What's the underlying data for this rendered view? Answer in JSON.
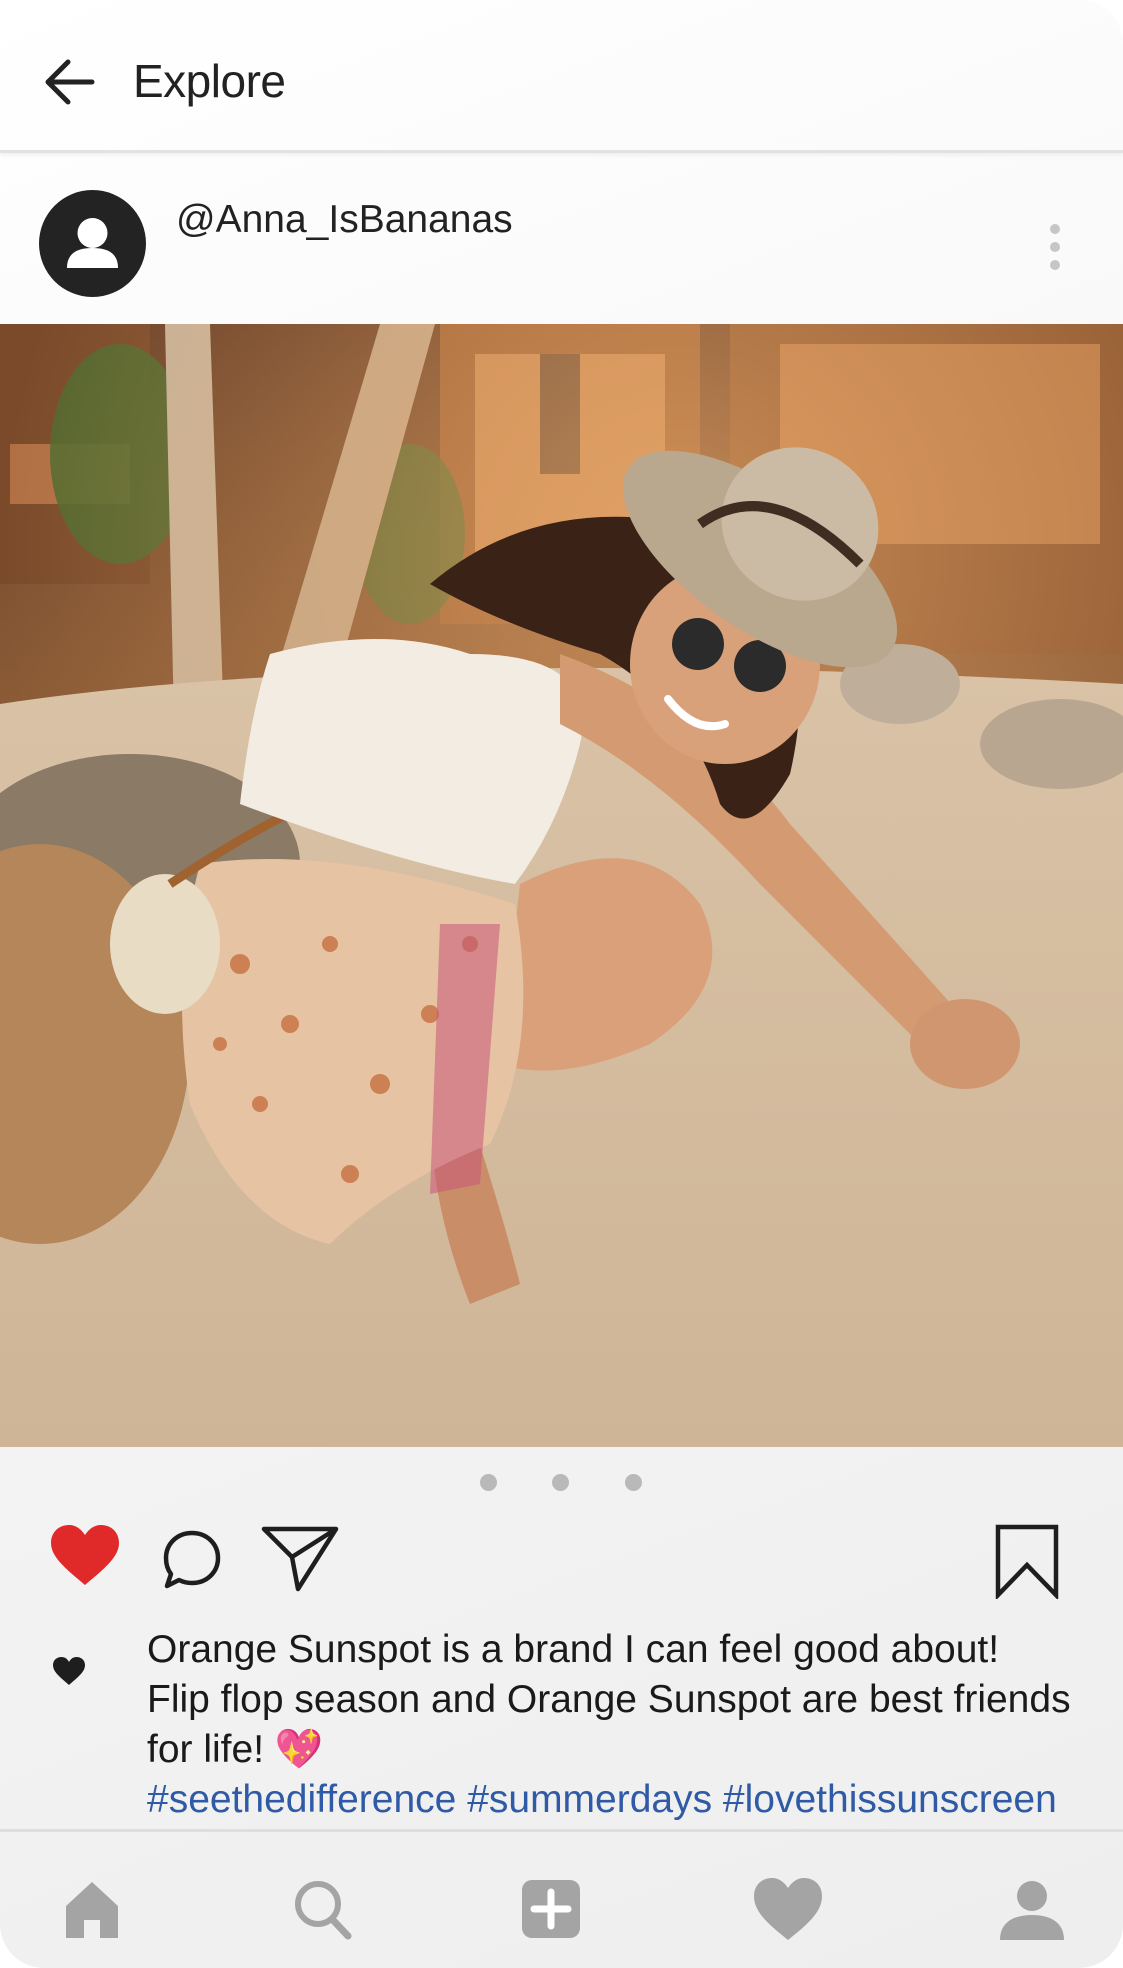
{
  "header": {
    "title": "Explore"
  },
  "post": {
    "username": "@Anna_IsBananas",
    "photo_description_icon": "beach-photo",
    "carousel": {
      "count": 3,
      "active": 1
    },
    "liked": true,
    "caption_lines": [
      "Orange Sunspot is a brand I can feel good about!",
      "Flip flop season and Orange Sunspot are best friends",
      "for life!"
    ],
    "caption_emoji": "💖",
    "hashtags": "#seethedifference #summerdays #lovethissunscreen"
  },
  "bottom_nav": {
    "items": [
      "home-icon",
      "search-icon",
      "add-post-icon",
      "activity-heart-icon",
      "profile-icon"
    ]
  },
  "colors": {
    "like_red": "#e02a2a",
    "hashtag_blue": "#2e5aa6",
    "nav_gray": "#a4a4a4"
  }
}
